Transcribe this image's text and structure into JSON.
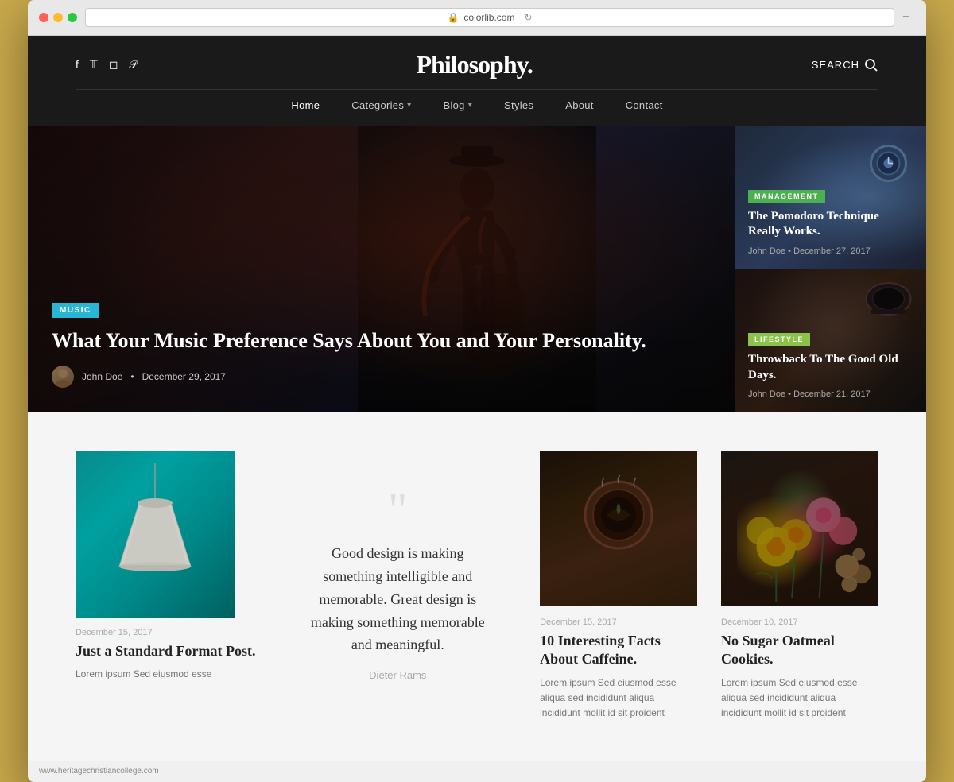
{
  "browser": {
    "url": "colorlib.com",
    "plus_label": "+"
  },
  "header": {
    "logo": "Philosophy.",
    "search_label": "SEARCH",
    "social_icons": [
      "f",
      "𝕏",
      "📷",
      "𝒫"
    ],
    "nav_items": [
      {
        "label": "Home",
        "active": true,
        "has_dropdown": false
      },
      {
        "label": "Categories",
        "active": false,
        "has_dropdown": true
      },
      {
        "label": "Blog",
        "active": false,
        "has_dropdown": true
      },
      {
        "label": "Styles",
        "active": false,
        "has_dropdown": false
      },
      {
        "label": "About",
        "active": false,
        "has_dropdown": false
      },
      {
        "label": "Contact",
        "active": false,
        "has_dropdown": false
      }
    ]
  },
  "hero": {
    "main_article": {
      "tag": "MUSIC",
      "title": "What Your Music Preference Says About You and Your Personality.",
      "author": "John Doe",
      "date": "December 29, 2017"
    },
    "sidebar_cards": [
      {
        "tag": "MANAGEMENT",
        "tag_class": "tag-management",
        "title": "The Pomodoro Technique Really Works.",
        "author": "John Doe",
        "date": "December 27, 2017"
      },
      {
        "tag": "LIFESTYLE",
        "tag_class": "tag-lifestyle",
        "title": "Throwback To The Good Old Days.",
        "author": "John Doe",
        "date": "December 21, 2017"
      }
    ]
  },
  "posts": {
    "lamp_post": {
      "date": "December 15, 2017",
      "title": "Just a Standard Format Post.",
      "excerpt": "Lorem ipsum Sed eiusmod esse"
    },
    "quote": {
      "text": "Good design is making something intelligible and memorable. Great design is making something memorable and meaningful.",
      "author": "Dieter Rams"
    },
    "caffeine_post": {
      "date": "December 15, 2017",
      "title": "10 Interesting Facts About Caffeine.",
      "excerpt": "Lorem ipsum Sed eiusmod esse aliqua sed incididunt aliqua incididunt mollit id sit proident"
    },
    "cookies_post": {
      "date": "December 10, 2017",
      "title": "No Sugar Oatmeal Cookies.",
      "excerpt": "Lorem ipsum Sed eiusmod esse aliqua sed incididunt aliqua incididunt mollit id sit proident"
    }
  },
  "footer": {
    "url": "www.heritagechristiancollege.com"
  }
}
